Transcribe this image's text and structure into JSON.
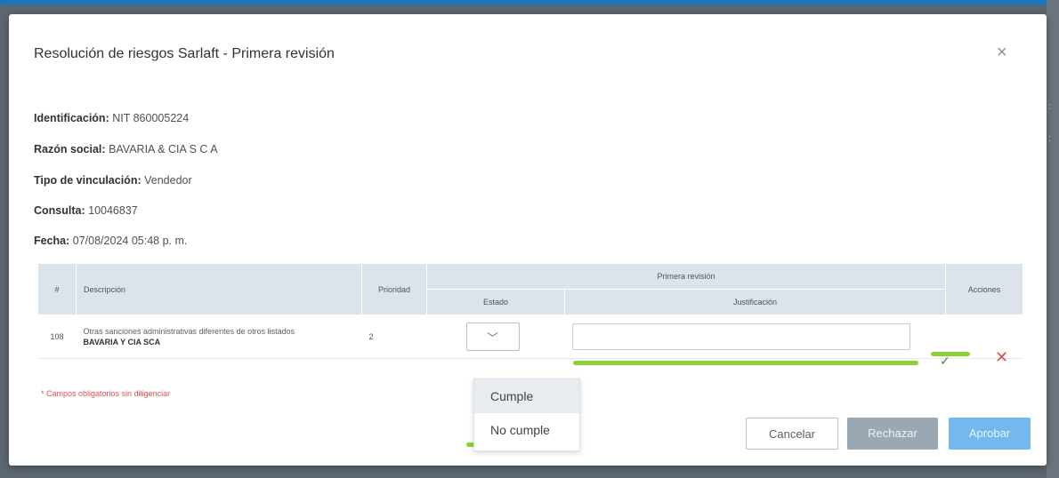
{
  "modal": {
    "title": "Resolución de riesgos Sarlaft - Primera revisión",
    "close_label": "×"
  },
  "info": {
    "identificacion_label": "Identificación:",
    "identificacion_value": "NIT 860005224",
    "razon_label": "Razón social:",
    "razon_value": "BAVARIA & CIA S C A",
    "tipo_label": "Tipo de vinculación:",
    "tipo_value": "Vendedor",
    "consulta_label": "Consulta:",
    "consulta_value": "10046837",
    "fecha_label": "Fecha:",
    "fecha_value": "07/08/2024 05:48 p. m."
  },
  "table": {
    "headers": {
      "num": "#",
      "descripcion": "Descripción",
      "prioridad": "Prioridad",
      "primera_revision": "Primera revisión",
      "estado": "Estado",
      "justificacion": "Justificación",
      "acciones": "Acciones"
    },
    "row": {
      "num": "108",
      "descripcion": "Otras sanciones administrativas diferentes de otros listados",
      "descripcion_sub": "BAVARIA Y CIA SCA",
      "prioridad": "2",
      "justificacion_value": ""
    }
  },
  "required_note": "* Campos obligatorios sin diligenciar",
  "dropdown": {
    "options": [
      "Cumple",
      "No cumple"
    ],
    "highlighted": "Cumple"
  },
  "buttons": {
    "cancel": "Cancelar",
    "reject": "Rechazar",
    "approve": "Aprobar"
  },
  "icons": {
    "close": "close-icon",
    "chevron": "chevron-down-icon",
    "check": "check-icon",
    "delete": "delete-icon"
  },
  "colors": {
    "accent_green": "#8bd236",
    "approve": "#73b8ef",
    "reject": "#9aa8b3",
    "delete": "#d9534f",
    "header_bg": "#dde3ea",
    "top_border": "#1f73b7"
  }
}
